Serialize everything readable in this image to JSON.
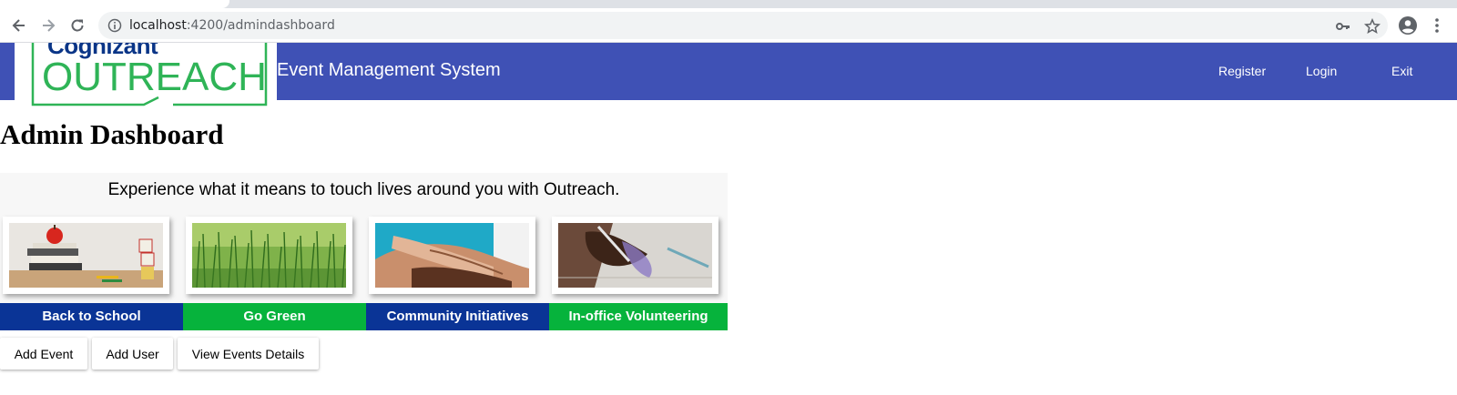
{
  "browser": {
    "url_host": "localhost",
    "url_rest": ":4200/admindashboard"
  },
  "header": {
    "logo_brand": "Cognizant",
    "logo_word": "OUTREACH",
    "app_title": "Event Management System",
    "nav": {
      "register": "Register",
      "login": "Login",
      "exit": "Exit"
    },
    "bg_color": "#3f51b5"
  },
  "main": {
    "page_title": "Admin Dashboard",
    "tagline": "Experience what it means to touch lives around you with Outreach.",
    "categories": [
      {
        "label": "Back to School",
        "color": "#0a3496"
      },
      {
        "label": "Go Green",
        "color": "#06b33c"
      },
      {
        "label": "Community Initiatives",
        "color": "#0a3496"
      },
      {
        "label": "In-office Volunteering",
        "color": "#06b33c"
      }
    ],
    "actions": {
      "add_event": "Add Event",
      "add_user": "Add User",
      "view_events": "View Events Details"
    }
  }
}
